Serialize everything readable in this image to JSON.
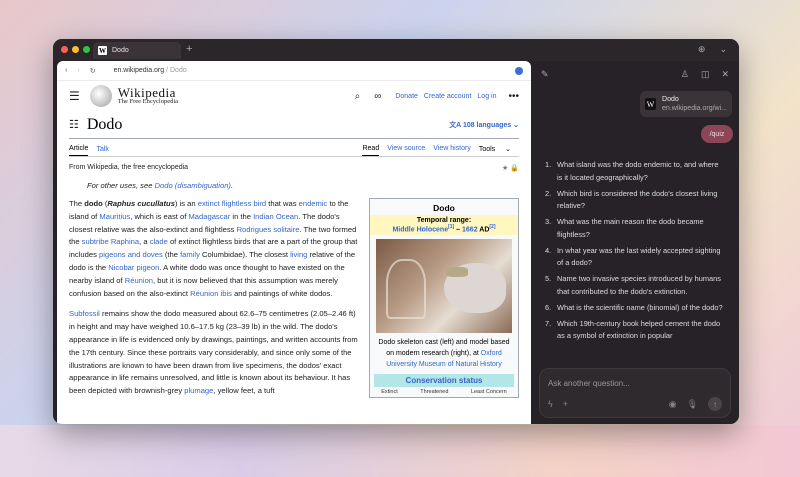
{
  "browser": {
    "tab_title": "Dodo",
    "new_tab": "+",
    "url_domain": "en.wikipedia.org",
    "url_path": " / Dodo"
  },
  "wikipedia": {
    "brand": "Wikipedia",
    "tagline": "The Free Encyclopedia",
    "donate": "Donate",
    "create_account": "Create account",
    "log_in": "Log in",
    "page_title": "Dodo",
    "languages": "108 languages",
    "tabs": {
      "article": "Article",
      "talk": "Talk",
      "read": "Read",
      "view_source": "View source",
      "view_history": "View history",
      "tools": "Tools"
    },
    "from": "From Wikipedia, the free encyclopedia",
    "hatnote_prefix": "For other uses, see ",
    "hatnote_link": "Dodo (disambiguation)",
    "hatnote_suffix": "."
  },
  "infobox": {
    "title": "Dodo",
    "temporal_label": "Temporal range:",
    "temporal_link": "Middle Holocene",
    "temporal_sup1": "[1]",
    "temporal_dash": " – ",
    "temporal_year": "1662",
    "temporal_ad": " AD",
    "temporal_sup2": "[2]",
    "caption_text": "Dodo skeleton cast (left) and model based on modern research (right), at ",
    "caption_link": "Oxford University Museum of Natural History",
    "conservation": "Conservation status",
    "scale": [
      "Extinct",
      "Threatened",
      "Least Concern"
    ]
  },
  "assistant": {
    "source_title": "Dodo",
    "source_url": "en.wikipedia.org/wi...",
    "user_message": "/quiz",
    "questions": [
      "What island was the dodo endemic to, and where is it located geographically?",
      "Which bird is considered the dodo's closest living relative?",
      "What was the main reason the dodo became flightless?",
      "In what year was the last widely accepted sighting of a dodo?",
      "Name two invasive species introduced by humans that contributed to the dodo's extinction.",
      "What is the scientific name (binomial) of the dodo?",
      "Which 19th-century book helped cement the dodo as a symbol of extinction in popular"
    ],
    "input_placeholder": "Ask another question..."
  },
  "colors": {
    "link": "#3366cc",
    "quiz_bubble": "#8b4657",
    "window_bg": "#262227"
  }
}
